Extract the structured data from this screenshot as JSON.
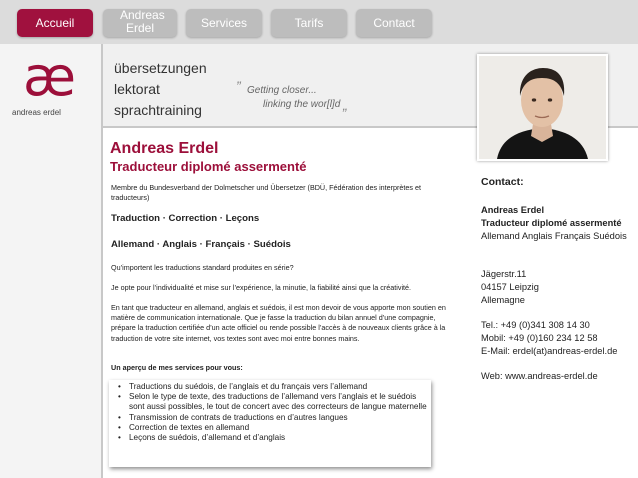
{
  "nav": {
    "tabs": [
      {
        "label": "Accueil",
        "active": true
      },
      {
        "label": "Andreas Erdel",
        "active": false
      },
      {
        "label": "Services",
        "active": false
      },
      {
        "label": "Tarifs",
        "active": false
      },
      {
        "label": "Contact",
        "active": false
      }
    ]
  },
  "logo": {
    "mark": "æ",
    "name": "andreas erdel"
  },
  "banner": {
    "lines": [
      "übersetzungen",
      "lektorat",
      "sprachtraining"
    ],
    "quote_line1": "Getting closer...",
    "quote_line2": "linking the wor[l]d",
    "quote_open": "”",
    "quote_close": "„"
  },
  "main": {
    "title": "Andreas Erdel",
    "subtitle": "Traducteur diplomé assermenté",
    "membership": "Membre du Bundesverband der Dolmetscher und Übersetzer (BDÜ, Fédération des interprètes et traducteurs)",
    "services_line": "Traduction · Correction · Leçons",
    "languages_line": "Allemand · Anglais · Français · Suédois",
    "para1": "Qu’importent les traductions standard produites en série?",
    "para2": "Je opte pour l’individualité et mise sur l’expérience, la minutie, la fiabilité ainsi que la créativité.",
    "para3": "En tant que traducteur en allemand, anglais et suédois, il est mon devoir de vous apporte mon soutien en matière de communication internationale. Que je fasse la traduction du bilan annuel d’une compagnie, prépare la traduction certifiée d’un acte officiel ou rende possible l’accès à de nouveaux clients grâce à la traduction de votre site internet, vos textes sont avec moi entre bonnes mains.",
    "services_heading": "Un aperçu de mes services pour vous:",
    "services": [
      "Traductions du suédois, de l’anglais et du français vers l’allemand",
      "Selon le type de texte, des traductions de l’allemand vers l’anglais et le suédois sont aussi possibles, le tout de concert avec des correcteurs de langue maternelle",
      "Transmission de contrats de traductions en d’autres langues",
      "Correction de textes en allemand",
      "Leçons de suédois, d’allemand et d’anglais"
    ]
  },
  "contact": {
    "heading": "Contact:",
    "name": "Andreas Erdel",
    "title": "Traducteur diplomé assermenté",
    "languages": "Allemand Anglais Français Suédois",
    "street": "Jägerstr.11",
    "city": "04157 Leipzig",
    "country": "Allemagne",
    "tel": "Tel.: +49 (0)341 308 14 30",
    "mobil": "Mobil: +49 (0)160 234 12 58",
    "email": "E-Mail: erdel(at)andreas-erdel.de",
    "web": "Web: www.andreas-erdel.de"
  },
  "colors": {
    "accent": "#a0113e",
    "tab_inactive": "#bdbdbd",
    "nav_bg": "#dcdcdc"
  }
}
